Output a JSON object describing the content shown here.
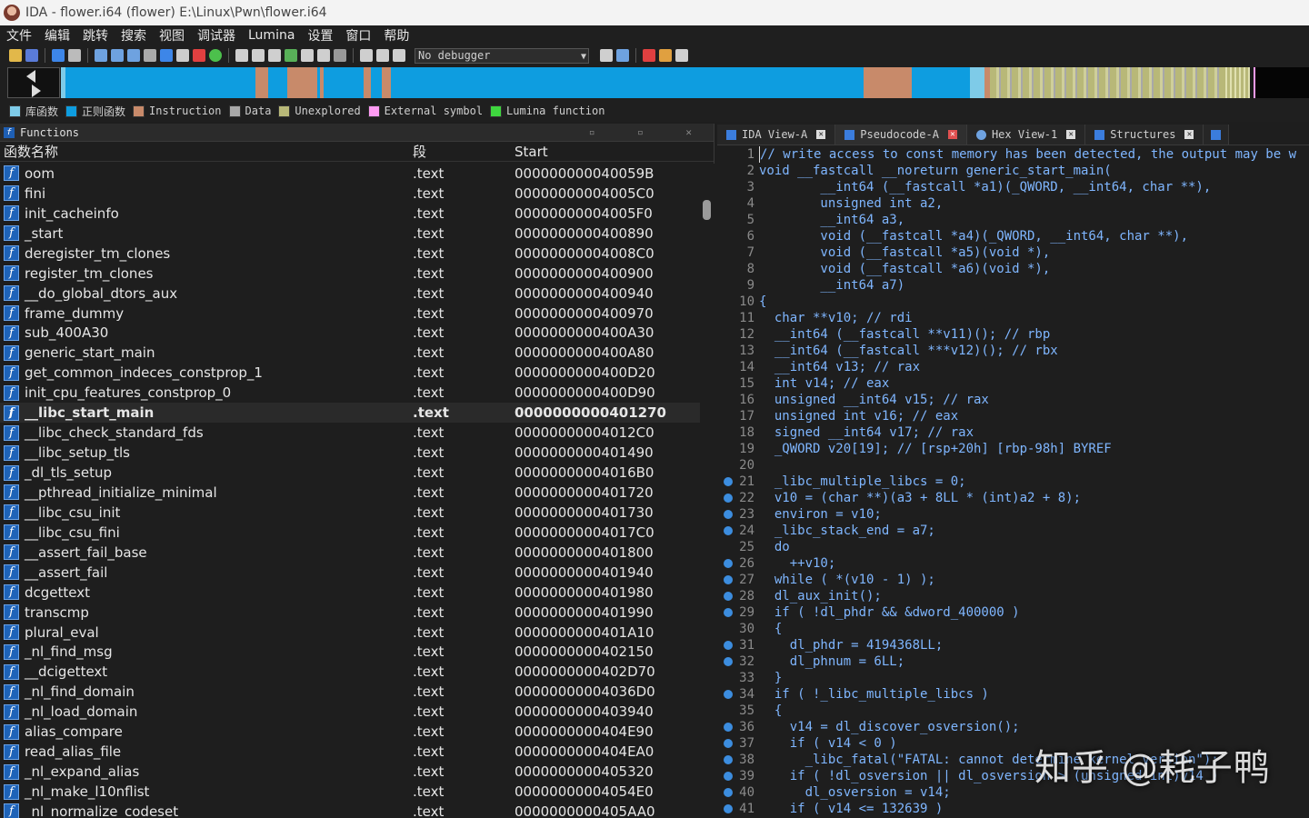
{
  "window": {
    "title": "IDA - flower.i64 (flower) E:\\Linux\\Pwn\\flower.i64"
  },
  "menu": [
    "文件",
    "编辑",
    "跳转",
    "搜索",
    "视图",
    "调试器",
    "Lumina",
    "设置",
    "窗口",
    "帮助"
  ],
  "toolbar": {
    "debugger": "No debugger"
  },
  "nav_colors": {
    "library": "#7ecbe8",
    "regular": "#0e9de0",
    "instruction": "#c88a6a",
    "data": "#a8a8a8",
    "unexplored": "#b8b878",
    "external": "#ff9bf3",
    "lumina": "#3fd63f"
  },
  "legend": [
    {
      "label": "库函数",
      "color": "#7ecbe8"
    },
    {
      "label": "正则函数",
      "color": "#0e9de0"
    },
    {
      "label": "Instruction",
      "color": "#c88a6a"
    },
    {
      "label": "Data",
      "color": "#a8a8a8"
    },
    {
      "label": "Unexplored",
      "color": "#b8b878"
    },
    {
      "label": "External symbol",
      "color": "#ff9bf3"
    },
    {
      "label": "Lumina function",
      "color": "#3fd63f"
    }
  ],
  "functions": {
    "title": "Functions",
    "columns": {
      "name": "函数名称",
      "segment": "段",
      "start": "Start"
    },
    "rows": [
      {
        "name": "oom",
        "segment": ".text",
        "start": "000000000040059B"
      },
      {
        "name": "fini",
        "segment": ".text",
        "start": "00000000004005C0"
      },
      {
        "name": "init_cacheinfo",
        "segment": ".text",
        "start": "00000000004005F0"
      },
      {
        "name": "_start",
        "segment": ".text",
        "start": "0000000000400890"
      },
      {
        "name": "deregister_tm_clones",
        "segment": ".text",
        "start": "00000000004008C0"
      },
      {
        "name": "register_tm_clones",
        "segment": ".text",
        "start": "0000000000400900"
      },
      {
        "name": "__do_global_dtors_aux",
        "segment": ".text",
        "start": "0000000000400940"
      },
      {
        "name": "frame_dummy",
        "segment": ".text",
        "start": "0000000000400970"
      },
      {
        "name": "sub_400A30",
        "segment": ".text",
        "start": "0000000000400A30"
      },
      {
        "name": "generic_start_main",
        "segment": ".text",
        "start": "0000000000400A80"
      },
      {
        "name": "get_common_indeces_constprop_1",
        "segment": ".text",
        "start": "0000000000400D20"
      },
      {
        "name": "init_cpu_features_constprop_0",
        "segment": ".text",
        "start": "0000000000400D90"
      },
      {
        "name": "__libc_start_main",
        "segment": ".text",
        "start": "0000000000401270",
        "selected": true
      },
      {
        "name": "__libc_check_standard_fds",
        "segment": ".text",
        "start": "00000000004012C0"
      },
      {
        "name": "__libc_setup_tls",
        "segment": ".text",
        "start": "0000000000401490"
      },
      {
        "name": "_dl_tls_setup",
        "segment": ".text",
        "start": "00000000004016B0"
      },
      {
        "name": "__pthread_initialize_minimal",
        "segment": ".text",
        "start": "0000000000401720"
      },
      {
        "name": "__libc_csu_init",
        "segment": ".text",
        "start": "0000000000401730"
      },
      {
        "name": "__libc_csu_fini",
        "segment": ".text",
        "start": "00000000004017C0"
      },
      {
        "name": "__assert_fail_base",
        "segment": ".text",
        "start": "0000000000401800"
      },
      {
        "name": "__assert_fail",
        "segment": ".text",
        "start": "0000000000401940"
      },
      {
        "name": "dcgettext",
        "segment": ".text",
        "start": "0000000000401980"
      },
      {
        "name": "transcmp",
        "segment": ".text",
        "start": "0000000000401990"
      },
      {
        "name": "plural_eval",
        "segment": ".text",
        "start": "0000000000401A10"
      },
      {
        "name": "_nl_find_msg",
        "segment": ".text",
        "start": "0000000000402150"
      },
      {
        "name": "__dcigettext",
        "segment": ".text",
        "start": "0000000000402D70"
      },
      {
        "name": "_nl_find_domain",
        "segment": ".text",
        "start": "00000000004036D0"
      },
      {
        "name": "_nl_load_domain",
        "segment": ".text",
        "start": "0000000000403940"
      },
      {
        "name": "alias_compare",
        "segment": ".text",
        "start": "0000000000404E90"
      },
      {
        "name": "read_alias_file",
        "segment": ".text",
        "start": "0000000000404EA0"
      },
      {
        "name": "_nl_expand_alias",
        "segment": ".text",
        "start": "0000000000405320"
      },
      {
        "name": "_nl_make_l10nflist",
        "segment": ".text",
        "start": "00000000004054E0"
      },
      {
        "name": "_nl_normalize_codeset",
        "segment": ".text",
        "start": "0000000000405AA0"
      }
    ]
  },
  "tabs": [
    {
      "label": "IDA View-A",
      "active": false
    },
    {
      "label": "Pseudocode-A",
      "active": true
    },
    {
      "label": "Hex View-1",
      "active": false
    },
    {
      "label": "Structures",
      "active": false
    }
  ],
  "pseudocode": [
    {
      "n": "1",
      "t": "// write access to const memory has been detected, the output may be w",
      "dot": false
    },
    {
      "n": "2",
      "t": "void __fastcall __noreturn generic_start_main(",
      "dot": false
    },
    {
      "n": "3",
      "t": "        __int64 (__fastcall *a1)(_QWORD, __int64, char **),",
      "dot": false
    },
    {
      "n": "4",
      "t": "        unsigned int a2,",
      "dot": false
    },
    {
      "n": "5",
      "t": "        __int64 a3,",
      "dot": false
    },
    {
      "n": "6",
      "t": "        void (__fastcall *a4)(_QWORD, __int64, char **),",
      "dot": false
    },
    {
      "n": "7",
      "t": "        void (__fastcall *a5)(void *),",
      "dot": false
    },
    {
      "n": "8",
      "t": "        void (__fastcall *a6)(void *),",
      "dot": false
    },
    {
      "n": "9",
      "t": "        __int64 a7)",
      "dot": false
    },
    {
      "n": "10",
      "t": "{",
      "dot": false
    },
    {
      "n": "11",
      "t": "  char **v10; // rdi",
      "dot": false
    },
    {
      "n": "12",
      "t": "  __int64 (__fastcall **v11)(); // rbp",
      "dot": false
    },
    {
      "n": "13",
      "t": "  __int64 (__fastcall ***v12)(); // rbx",
      "dot": false
    },
    {
      "n": "14",
      "t": "  __int64 v13; // rax",
      "dot": false
    },
    {
      "n": "15",
      "t": "  int v14; // eax",
      "dot": false
    },
    {
      "n": "16",
      "t": "  unsigned __int64 v15; // rax",
      "dot": false
    },
    {
      "n": "17",
      "t": "  unsigned int v16; // eax",
      "dot": false
    },
    {
      "n": "18",
      "t": "  signed __int64 v17; // rax",
      "dot": false
    },
    {
      "n": "19",
      "t": "  _QWORD v20[19]; // [rsp+20h] [rbp-98h] BYREF",
      "dot": false
    },
    {
      "n": "20",
      "t": "",
      "dot": false
    },
    {
      "n": "21",
      "t": "  _libc_multiple_libcs = 0;",
      "dot": true
    },
    {
      "n": "22",
      "t": "  v10 = (char **)(a3 + 8LL * (int)a2 + 8);",
      "dot": true
    },
    {
      "n": "23",
      "t": "  environ = v10;",
      "dot": true
    },
    {
      "n": "24",
      "t": "  _libc_stack_end = a7;",
      "dot": true
    },
    {
      "n": "25",
      "t": "  do",
      "dot": false
    },
    {
      "n": "26",
      "t": "    ++v10;",
      "dot": true
    },
    {
      "n": "27",
      "t": "  while ( *(v10 - 1) );",
      "dot": true
    },
    {
      "n": "28",
      "t": "  dl_aux_init();",
      "dot": true
    },
    {
      "n": "29",
      "t": "  if ( !dl_phdr && &dword_400000 )",
      "dot": true
    },
    {
      "n": "30",
      "t": "  {",
      "dot": false
    },
    {
      "n": "31",
      "t": "    dl_phdr = 4194368LL;",
      "dot": true
    },
    {
      "n": "32",
      "t": "    dl_phnum = 6LL;",
      "dot": true
    },
    {
      "n": "33",
      "t": "  }",
      "dot": false
    },
    {
      "n": "34",
      "t": "  if ( !_libc_multiple_libcs )",
      "dot": true
    },
    {
      "n": "35",
      "t": "  {",
      "dot": false
    },
    {
      "n": "36",
      "t": "    v14 = dl_discover_osversion();",
      "dot": true
    },
    {
      "n": "37",
      "t": "    if ( v14 < 0 )",
      "dot": true
    },
    {
      "n": "38",
      "t": "      _libc_fatal(\"FATAL: cannot determine kernel version\");",
      "dot": true
    },
    {
      "n": "39",
      "t": "    if ( !dl_osversion || dl_osversion > (unsigned int)v14 )",
      "dot": true
    },
    {
      "n": "40",
      "t": "      dl_osversion = v14;",
      "dot": true
    },
    {
      "n": "41",
      "t": "    if ( v14 <= 132639 )",
      "dot": true
    }
  ],
  "watermark": "知乎 @耗子鸭"
}
